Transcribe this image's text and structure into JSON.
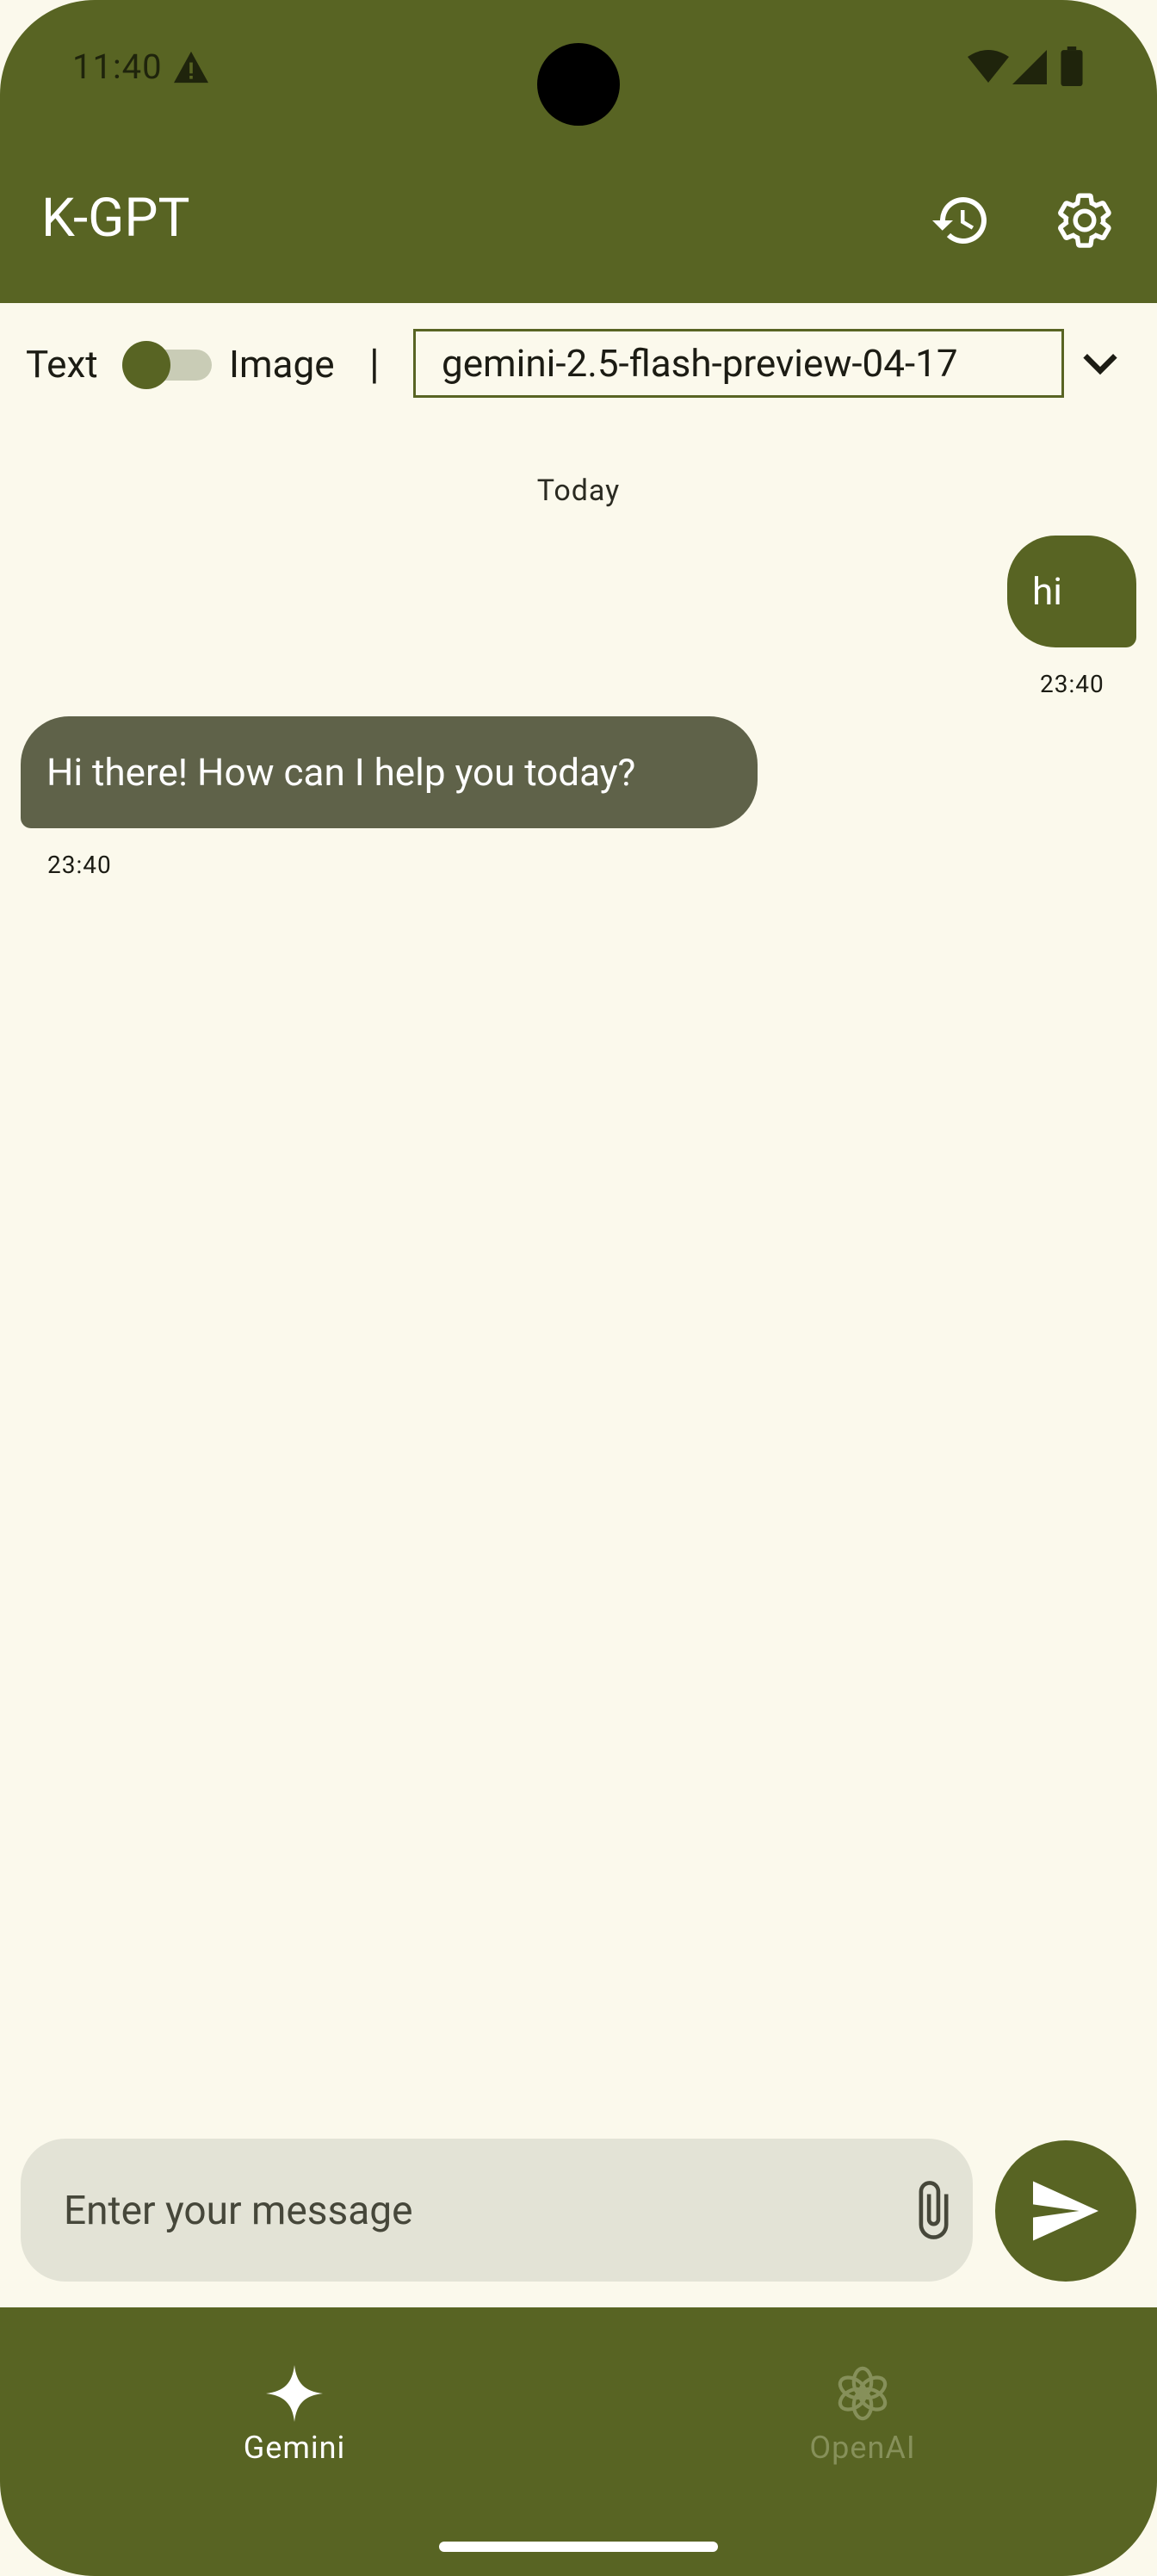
{
  "status_bar": {
    "time": "11:40",
    "icons": [
      "warning-icon",
      "wifi-icon",
      "signal-icon",
      "battery-icon"
    ]
  },
  "app_bar": {
    "title": "K-GPT",
    "actions": [
      "history-icon",
      "settings-icon"
    ]
  },
  "mode_toggle": {
    "left_label": "Text",
    "right_label": "Image",
    "selected": "Text",
    "separator": "|"
  },
  "model_selector": {
    "value": "gemini-2.5-flash-preview-04-17"
  },
  "chat": {
    "day_label": "Today",
    "messages": [
      {
        "sender": "user",
        "text": "hi",
        "time": "23:40"
      },
      {
        "sender": "assistant",
        "text": "Hi there! How can I help you today?",
        "time": "23:40"
      }
    ]
  },
  "composer": {
    "placeholder": "Enter your message",
    "value": ""
  },
  "bottom_nav": {
    "items": [
      {
        "label": "Gemini",
        "icon": "sparkle-icon",
        "selected": true
      },
      {
        "label": "OpenAI",
        "icon": "openai-icon",
        "selected": false
      }
    ]
  },
  "colors": {
    "primary": "#586423",
    "background": "#FBF9EC",
    "assistant_bubble": "#5F6249",
    "input_background": "#E3E3D6",
    "nav_inactive": "#86905A"
  }
}
